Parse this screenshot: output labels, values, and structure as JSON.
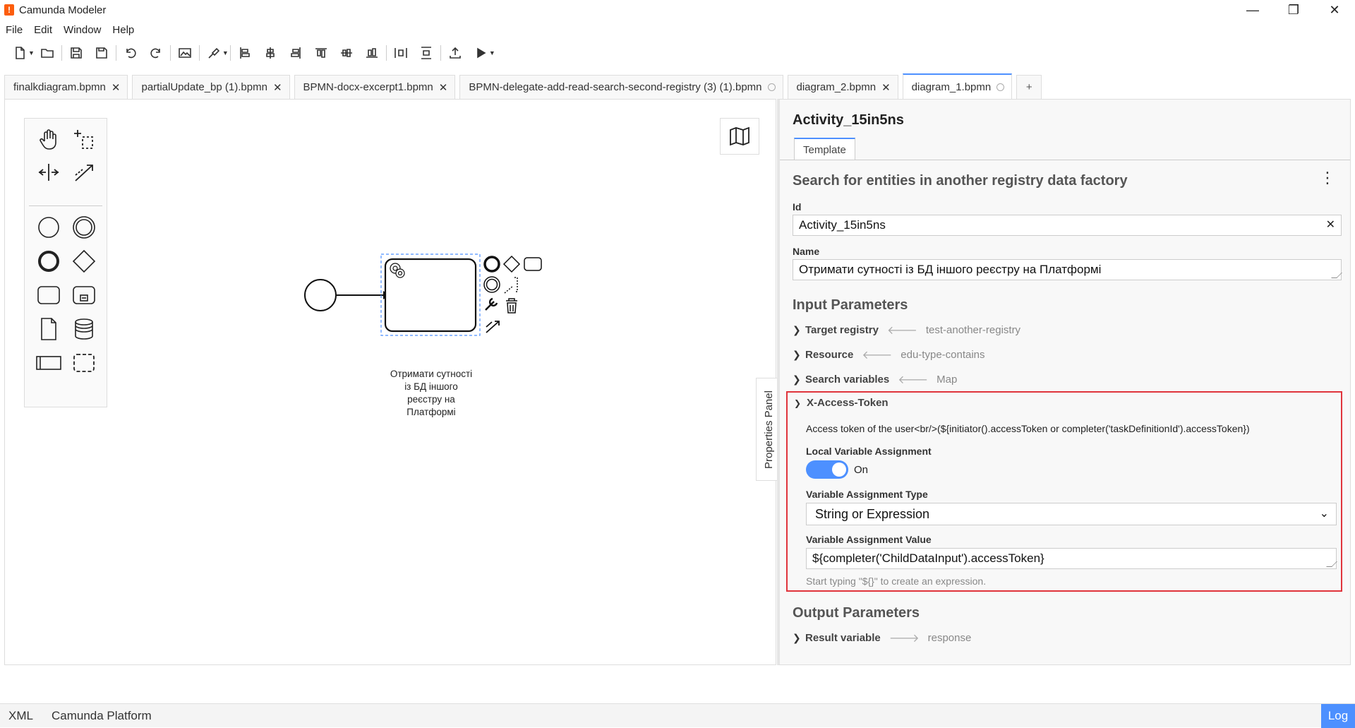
{
  "window": {
    "title": "Camunda Modeler",
    "logo_glyph": "!",
    "accent_color": "#4d90ff",
    "highlight_color": "#e0343c"
  },
  "menu": [
    "File",
    "Edit",
    "Window",
    "Help"
  ],
  "tabs": [
    {
      "label": "finalkdiagram.bpmn",
      "state": "close"
    },
    {
      "label": "partialUpdate_bp (1).bpmn",
      "state": "close"
    },
    {
      "label": "BPMN-docx-excerpt1.bpmn",
      "state": "close"
    },
    {
      "label": "BPMN-delegate-add-read-search-second-registry (3) (1).bpmn",
      "state": "dot"
    },
    {
      "label": "diagram_2.bpmn",
      "state": "close"
    },
    {
      "label": "diagram_1.bpmn",
      "state": "dot",
      "active": true
    }
  ],
  "add_tab_label": "+",
  "diagram": {
    "task_label": "Отримати сутності із БД іншого реєстру на Платформі"
  },
  "properties_toggle_label": "Properties Panel",
  "properties": {
    "element_id_title": "Activity_15in5ns",
    "tab_label": "Template",
    "template_title": "Search for entities in another registry data factory",
    "id_label": "Id",
    "id_value": "Activity_15in5ns",
    "name_label": "Name",
    "name_value": "Отримати сутності із БД іншого реєстру на Платформі",
    "input_params_title": "Input Parameters",
    "input_params": [
      {
        "name": "Target registry",
        "value": "test-another-registry"
      },
      {
        "name": "Resource",
        "value": "edu-type-contains"
      },
      {
        "name": "Search variables",
        "value": "Map"
      }
    ],
    "x_access_token": {
      "name": "X-Access-Token",
      "description": "Access token of the user<br/>(${initiator().accessToken or completer('taskDefinitionId').accessToken})",
      "local_var_label": "Local Variable Assignment",
      "toggle_state": "On",
      "assignment_type_label": "Variable Assignment Type",
      "assignment_type_value": "String or Expression",
      "assignment_value_label": "Variable Assignment Value",
      "assignment_value": "${completer('ChildDataInput').accessToken}",
      "hint": "Start typing \"${}\" to create an expression."
    },
    "output_params_title": "Output Parameters",
    "output_params": [
      {
        "name": "Result variable",
        "value": "response"
      }
    ]
  },
  "statusbar": {
    "xml_label": "XML",
    "platform_label": "Camunda Platform",
    "log_label": "Log"
  }
}
